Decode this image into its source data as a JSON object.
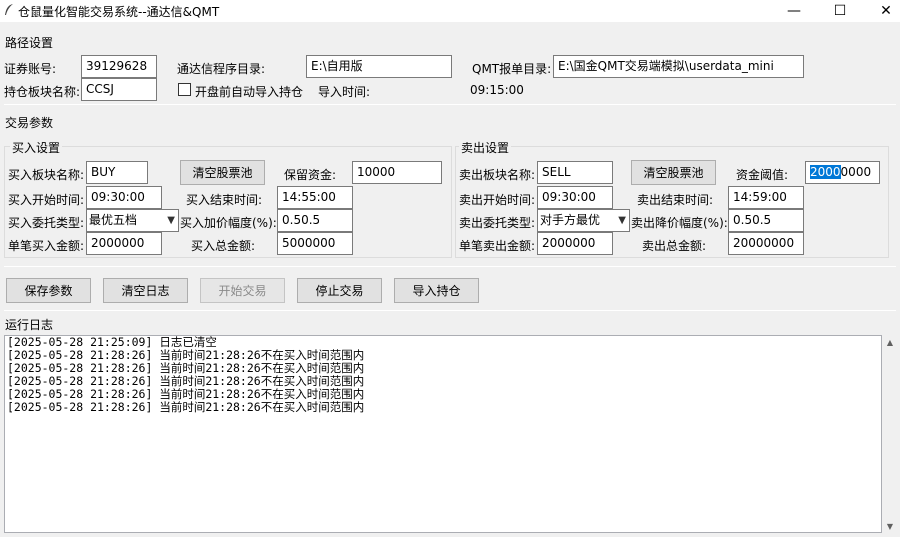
{
  "window": {
    "title": "仓鼠量化智能交易系统--通达信&QMT",
    "minimize": "—",
    "maximize": "☐",
    "close": "✕"
  },
  "path_section": {
    "title": "路径设置",
    "account_label": "证券账号:",
    "account_value": "39129628",
    "tdx_dir_label": "通达信程序目录:",
    "tdx_dir_value": "E:\\自用版",
    "qmt_dir_label": "QMT报单目录:",
    "qmt_dir_value": "E:\\国金QMT交易端模拟\\userdata_mini",
    "holding_block_label": "持仓板块名称:",
    "holding_block_value": "CCSJ",
    "auto_import_label": "开盘前自动导入持仓",
    "import_time_label": "导入时间:",
    "import_time_value": "09:15:00"
  },
  "trade_params": {
    "title": "交易参数",
    "buy": {
      "title": "买入设置",
      "block_label": "买入板块名称:",
      "block_value": "BUY",
      "clear_button": "清空股票池",
      "reserve_label": "保留资金:",
      "reserve_value": "10000",
      "start_label": "买入开始时间:",
      "start_value": "09:30:00",
      "end_label": "买入结束时间:",
      "end_value": "14:55:00",
      "order_type_label": "买入委托类型:",
      "order_type_value": "最优五档",
      "markup_label": "买入加价幅度(%):",
      "markup_value": "0.50.5",
      "single_amount_label": "单笔买入金额:",
      "single_amount_value": "2000000",
      "total_amount_label": "买入总金额:",
      "total_amount_value": "5000000"
    },
    "sell": {
      "title": "卖出设置",
      "block_label": "卖出板块名称:",
      "block_value": "SELL",
      "clear_button": "清空股票池",
      "threshold_label": "资金阈值:",
      "threshold_selected": "2000",
      "threshold_rest": "0000",
      "start_label": "卖出开始时间:",
      "start_value": "09:30:00",
      "end_label": "卖出结束时间:",
      "end_value": "14:59:00",
      "order_type_label": "卖出委托类型:",
      "order_type_value": "对手方最优",
      "markdown_label": "卖出降价幅度(%):",
      "markdown_value": "0.50.5",
      "single_amount_label": "单笔卖出金额:",
      "single_amount_value": "2000000",
      "total_amount_label": "卖出总金额:",
      "total_amount_value": "20000000"
    }
  },
  "buttons": {
    "save": "保存参数",
    "clear_log": "清空日志",
    "start": "开始交易",
    "stop": "停止交易",
    "import_holding": "导入持仓"
  },
  "log": {
    "title": "运行日志",
    "lines": [
      "[2025-05-28 21:25:09] 日志已清空",
      "[2025-05-28 21:28:26] 当前时间21:28:26不在买入时间范围内",
      "[2025-05-28 21:28:26] 当前时间21:28:26不在买入时间范围内",
      "[2025-05-28 21:28:26] 当前时间21:28:26不在买入时间范围内",
      "[2025-05-28 21:28:26] 当前时间21:28:26不在买入时间范围内",
      "[2025-05-28 21:28:26] 当前时间21:28:26不在买入时间范围内"
    ]
  },
  "icons": {
    "app": "feather-icon",
    "combo_arrow": "chevron-down-icon",
    "scroll_up": "arrow-up-icon",
    "scroll_down": "arrow-down-icon"
  },
  "colors": {
    "selection": "#0078d7",
    "window_bg": "#f0f0f0"
  }
}
